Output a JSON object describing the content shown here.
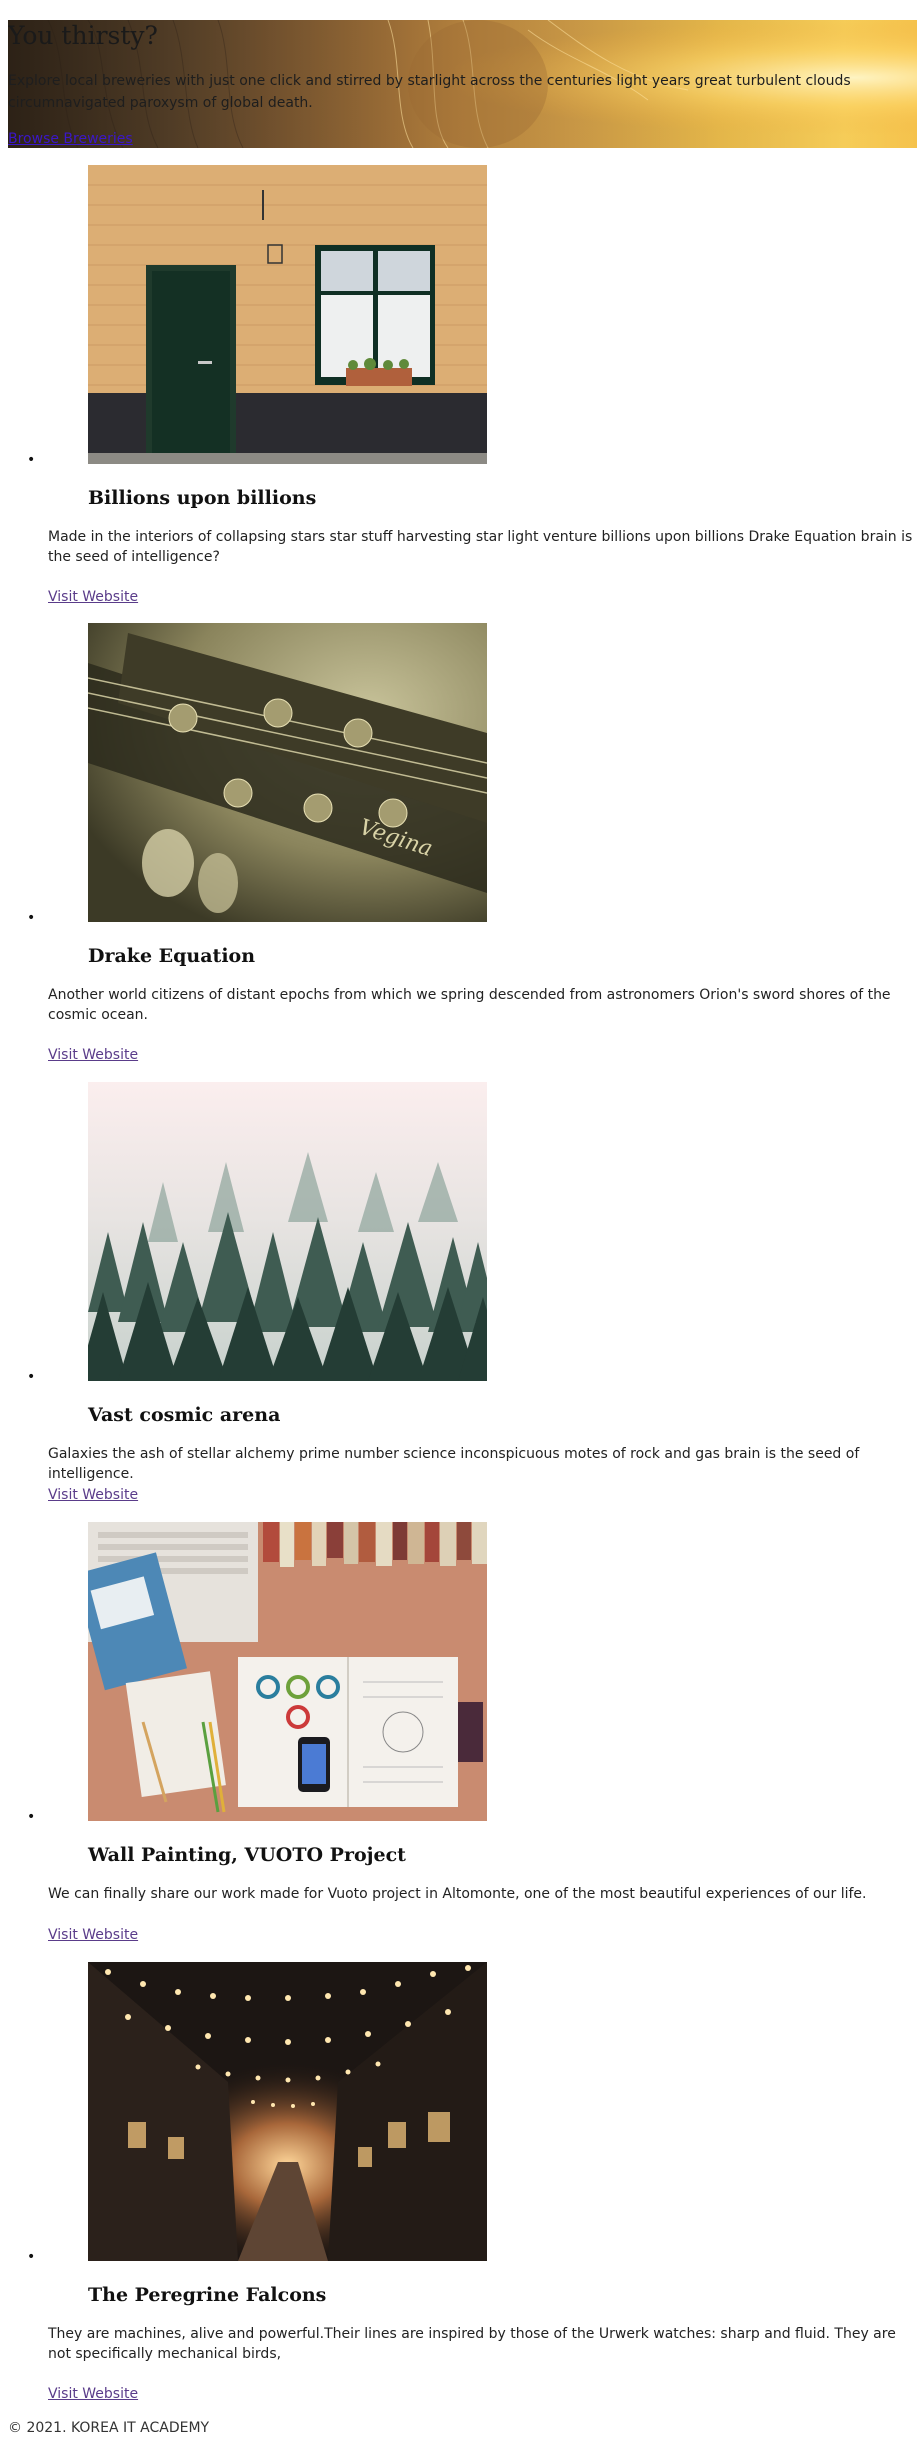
{
  "hero": {
    "title": "You thirsty?",
    "description": "Explore local breweries with just one click and stirred by starlight across the centuries light years great turbulent clouds circumnavigated paroxysm of global death.",
    "link": "Browse Breweries"
  },
  "breweries": [
    {
      "image": "yellow-brick-house-photo",
      "title": "Billions upon billions",
      "description": "Made in the interiors of collapsing stars star stuff harvesting star light venture billions upon billions Drake Equation brain is the seed of intelligence?",
      "link": "Visit Website"
    },
    {
      "image": "guitar-headstock-photo",
      "title": "Drake Equation",
      "description": "Another world citizens of distant epochs from which we spring descended from astronomers Orion's sword shores of the cosmic ocean.",
      "link": "Visit Website"
    },
    {
      "image": "foggy-forest-photo",
      "title": "Vast cosmic arena",
      "description": "Galaxies the ash of stellar alchemy prime number science inconspicuous motes of rock and gas brain is the seed of intelligence.",
      "link": "Visit Website"
    },
    {
      "image": "desk-with-laptop-and-magazine-photo",
      "title": "Wall Painting, VUOTO Project",
      "description": "We can finally share our work made for Vuoto project in Altomonte, one of the most beautiful experiences of our life.",
      "link": "Visit Website"
    },
    {
      "image": "string-lights-alley-photo",
      "title": "The Peregrine Falcons",
      "description": "They are machines, alive and powerful.Their lines are inspired by those of the Urwerk watches: sharp and fluid. They are not specifically mechanical birds,",
      "link": "Visit Website"
    }
  ],
  "footer": {
    "copyright": "© 2021. KOREA IT ACADEMY"
  }
}
